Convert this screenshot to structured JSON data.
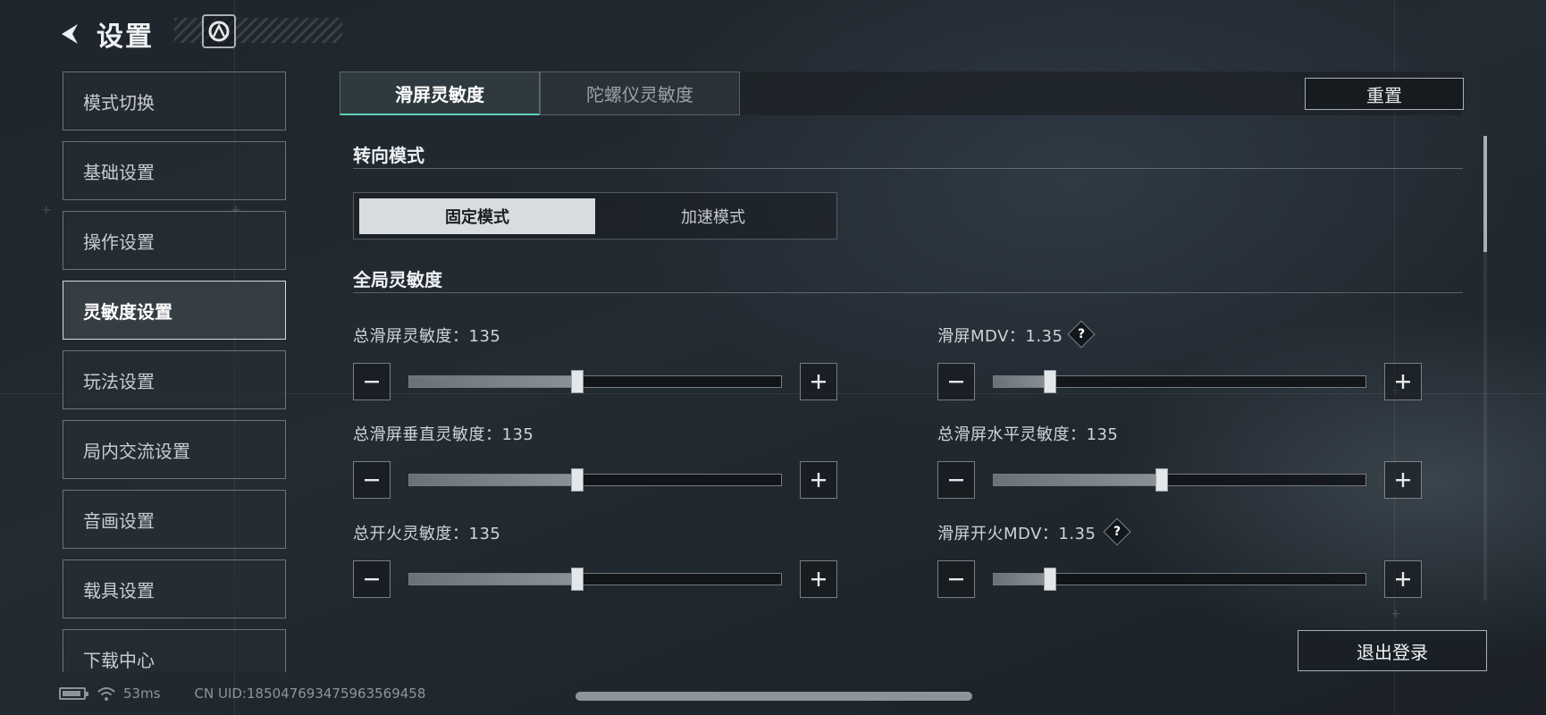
{
  "header": {
    "title": "设置"
  },
  "sidebar": {
    "items": [
      {
        "label": "模式切换",
        "active": false
      },
      {
        "label": "基础设置",
        "active": false
      },
      {
        "label": "操作设置",
        "active": false
      },
      {
        "label": "灵敏度设置",
        "active": true
      },
      {
        "label": "玩法设置",
        "active": false
      },
      {
        "label": "局内交流设置",
        "active": false
      },
      {
        "label": "音画设置",
        "active": false
      },
      {
        "label": "载具设置",
        "active": false
      },
      {
        "label": "下载中心",
        "active": false
      }
    ]
  },
  "tabs": [
    {
      "label": "滑屏灵敏度",
      "active": true
    },
    {
      "label": "陀螺仪灵敏度",
      "active": false
    }
  ],
  "reset_label": "重置",
  "steering": {
    "title": "转向模式",
    "options": [
      {
        "label": "固定模式",
        "active": true
      },
      {
        "label": "加速模式",
        "active": false
      }
    ]
  },
  "global": {
    "title": "全局灵敏度",
    "sliders": [
      {
        "label": "总滑屏灵敏度：135",
        "fraction": 0.45,
        "help": false
      },
      {
        "label": "滑屏MDV：1.35",
        "fraction": 0.15,
        "help": true
      },
      {
        "label": "总滑屏垂直灵敏度：135",
        "fraction": 0.45,
        "help": false
      },
      {
        "label": "总滑屏水平灵敏度：135",
        "fraction": 0.45,
        "help": false
      },
      {
        "label": "总开火灵敏度：135",
        "fraction": 0.45,
        "help": false
      },
      {
        "label": "滑屏开火MDV：1.35",
        "fraction": 0.15,
        "help": true
      }
    ]
  },
  "help_glyph": "?",
  "logout_label": "退出登录",
  "status": {
    "ping": "53ms",
    "uid": "CN UID:1850476934759635694​58"
  },
  "colors": {
    "accent": "#5fd0b8",
    "active_bg": "#d8dcde"
  }
}
